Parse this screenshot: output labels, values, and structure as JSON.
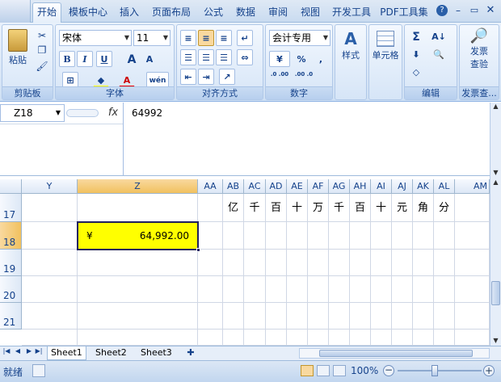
{
  "ribbon": {
    "tabs": [
      "开始",
      "模板中心",
      "插入",
      "页面布局",
      "公式",
      "数据",
      "审阅",
      "视图",
      "开发工具",
      "PDF工具集"
    ],
    "active_tab": "开始"
  },
  "clipboard": {
    "paste_label": "粘贴",
    "group_label": "剪贴板"
  },
  "font": {
    "name": "宋体",
    "size": "11",
    "group_label": "字体",
    "bold": "B",
    "italic": "I",
    "underline": "U",
    "grow": "A",
    "shrink": "A",
    "phonetic": "wén"
  },
  "alignment": {
    "group_label": "对齐方式"
  },
  "number": {
    "format": "会计专用",
    "percent": "%",
    "comma": ",",
    "inc_decimal": ".0 .00",
    "dec_decimal": ".00 .0",
    "group_label": "数字"
  },
  "styles": {
    "label": "样式"
  },
  "cells": {
    "label": "单元格"
  },
  "editing": {
    "group_label": "编辑"
  },
  "invoice": {
    "label_line1": "发票",
    "label_line2": "查验",
    "group_label": "发票查..."
  },
  "formula_bar": {
    "name_box": "Z18",
    "fx": "fx",
    "value": "64992"
  },
  "columns": [
    {
      "label": "Y"
    },
    {
      "label": "Z"
    },
    {
      "label": "AA"
    },
    {
      "label": "AB"
    },
    {
      "label": "AC"
    },
    {
      "label": "AD"
    },
    {
      "label": "AE"
    },
    {
      "label": "AF"
    },
    {
      "label": "AG"
    },
    {
      "label": "AH"
    },
    {
      "label": "AI"
    },
    {
      "label": "AJ"
    },
    {
      "label": "AK"
    },
    {
      "label": "AL"
    },
    {
      "label": "AM"
    }
  ],
  "rows": [
    "17",
    "18",
    "19",
    "20",
    "21"
  ],
  "row17_units": [
    "亿",
    "千",
    "百",
    "十",
    "万",
    "千",
    "百",
    "十",
    "元",
    "角",
    "分"
  ],
  "selected_cell": {
    "currency": "¥",
    "amount": "64,992.00"
  },
  "sheets": [
    "Sheet1",
    "Sheet2",
    "Sheet3"
  ],
  "status": {
    "mode": "就绪",
    "zoom": "100%"
  }
}
